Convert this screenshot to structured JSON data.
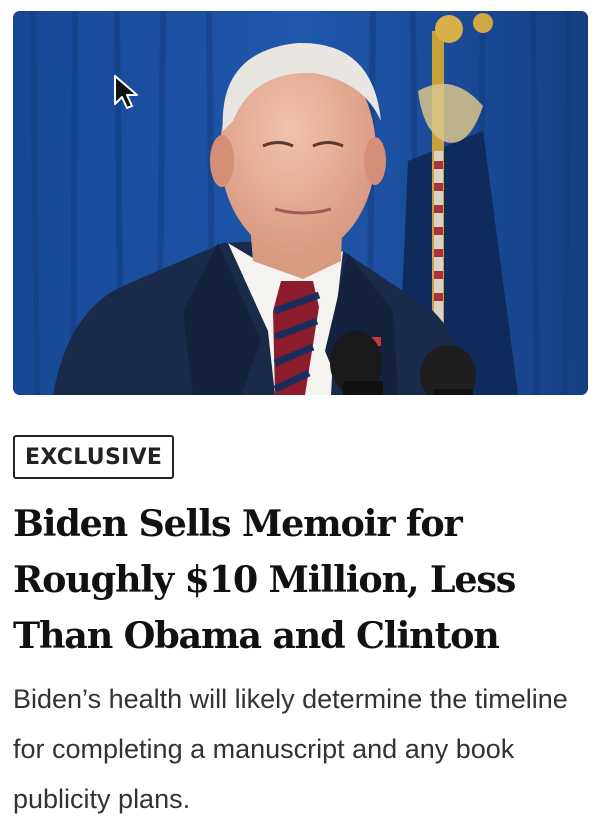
{
  "article": {
    "badge": "EXCLUSIVE",
    "headline": "Biden Sells Memoir for Roughly $10 Million, Less Than Obama and Clinton",
    "dek": "Biden’s health will likely determine the timeline for completing a manuscript and any book publicity plans."
  },
  "colors": {
    "curtain": "#1c4f9e",
    "badge_border": "#222222",
    "headline": "#111111",
    "dek": "#333333"
  }
}
